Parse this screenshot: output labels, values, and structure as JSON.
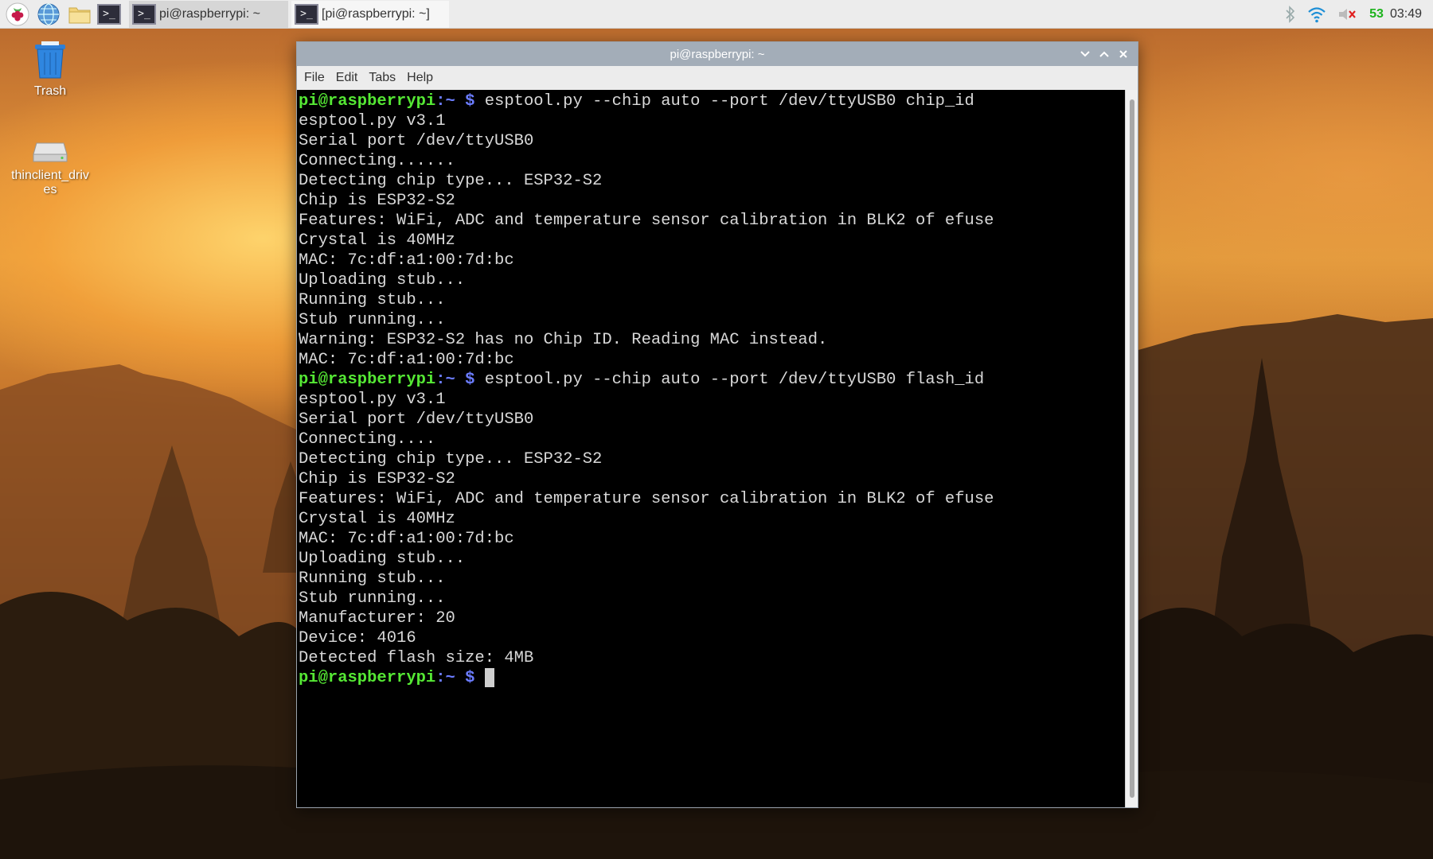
{
  "panel": {
    "taskbar": [
      {
        "label": "pi@raspberrypi: ~",
        "active": true
      },
      {
        "label": "[pi@raspberrypi: ~]",
        "active": false
      }
    ],
    "tray": {
      "cpu_usage": "53",
      "clock": "03:49"
    },
    "icons": [
      "raspberry-menu-icon",
      "web-browser-icon",
      "file-manager-icon",
      "terminal-icon",
      "bluetooth-icon",
      "wifi-icon",
      "volume-muted-icon"
    ]
  },
  "desktop": {
    "icons": [
      {
        "label": "Trash"
      },
      {
        "label": "thinclient_drives"
      }
    ]
  },
  "window": {
    "title": "pi@raspberrypi: ~",
    "menu": [
      "File",
      "Edit",
      "Tabs",
      "Help"
    ],
    "terminal": {
      "prompt_user": "pi@raspberrypi",
      "prompt_sep": ":~ $",
      "lines": [
        {
          "type": "prompt",
          "command": "esptool.py --chip auto --port /dev/ttyUSB0 chip_id"
        },
        {
          "type": "out",
          "text": "esptool.py v3.1"
        },
        {
          "type": "out",
          "text": "Serial port /dev/ttyUSB0"
        },
        {
          "type": "out",
          "text": "Connecting......"
        },
        {
          "type": "out",
          "text": "Detecting chip type... ESP32-S2"
        },
        {
          "type": "out",
          "text": "Chip is ESP32-S2"
        },
        {
          "type": "out",
          "text": "Features: WiFi, ADC and temperature sensor calibration in BLK2 of efuse"
        },
        {
          "type": "out",
          "text": "Crystal is 40MHz"
        },
        {
          "type": "out",
          "text": "MAC: 7c:df:a1:00:7d:bc"
        },
        {
          "type": "out",
          "text": "Uploading stub..."
        },
        {
          "type": "out",
          "text": "Running stub..."
        },
        {
          "type": "out",
          "text": "Stub running..."
        },
        {
          "type": "out",
          "text": "Warning: ESP32-S2 has no Chip ID. Reading MAC instead."
        },
        {
          "type": "out",
          "text": "MAC: 7c:df:a1:00:7d:bc"
        },
        {
          "type": "prompt",
          "command": "esptool.py --chip auto --port /dev/ttyUSB0 flash_id"
        },
        {
          "type": "out",
          "text": "esptool.py v3.1"
        },
        {
          "type": "out",
          "text": "Serial port /dev/ttyUSB0"
        },
        {
          "type": "out",
          "text": "Connecting...."
        },
        {
          "type": "out",
          "text": "Detecting chip type... ESP32-S2"
        },
        {
          "type": "out",
          "text": "Chip is ESP32-S2"
        },
        {
          "type": "out",
          "text": "Features: WiFi, ADC and temperature sensor calibration in BLK2 of efuse"
        },
        {
          "type": "out",
          "text": "Crystal is 40MHz"
        },
        {
          "type": "out",
          "text": "MAC: 7c:df:a1:00:7d:bc"
        },
        {
          "type": "out",
          "text": "Uploading stub..."
        },
        {
          "type": "out",
          "text": "Running stub..."
        },
        {
          "type": "out",
          "text": "Stub running..."
        },
        {
          "type": "out",
          "text": "Manufacturer: 20"
        },
        {
          "type": "out",
          "text": "Device: 4016"
        },
        {
          "type": "out",
          "text": "Detected flash size: 4MB"
        },
        {
          "type": "prompt",
          "command": "",
          "cursor": true
        }
      ]
    }
  },
  "colors": {
    "prompt_user": "#55e834",
    "prompt_path": "#6b7cff",
    "cpu": "#1db31d"
  }
}
